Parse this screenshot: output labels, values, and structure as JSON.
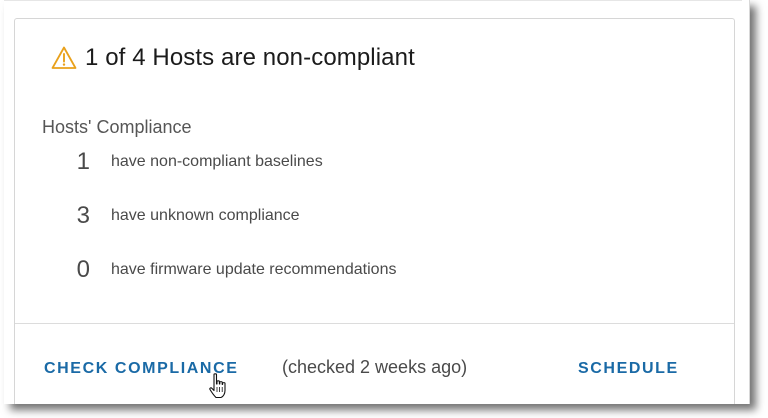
{
  "header": {
    "icon": "warning-icon",
    "title": "1 of 4 Hosts are non-compliant"
  },
  "compliance": {
    "label": "Hosts' Compliance",
    "rows": [
      {
        "count": "1",
        "text": "have non-compliant baselines"
      },
      {
        "count": "3",
        "text": "have unknown compliance"
      },
      {
        "count": "0",
        "text": "have firmware update recommendations"
      }
    ]
  },
  "footer": {
    "check_label": "CHECK COMPLIANCE",
    "checked_note": "(checked 2 weeks ago)",
    "schedule_label": "SCHEDULE"
  },
  "colors": {
    "accent": "#1a6aa6",
    "warning": "#e9a11b"
  }
}
